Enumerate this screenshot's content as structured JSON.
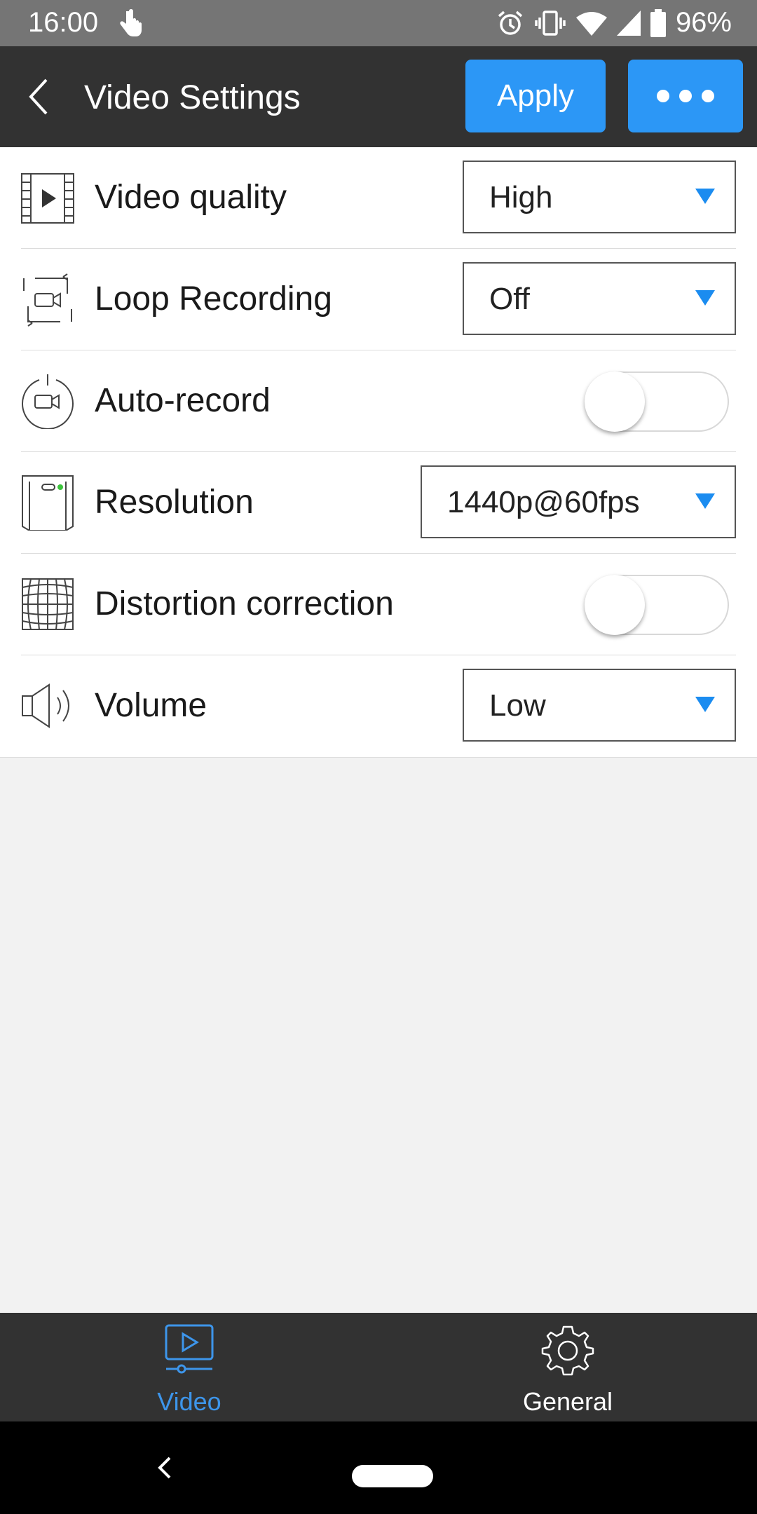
{
  "status_bar": {
    "time": "16:00",
    "battery": "96%"
  },
  "app_bar": {
    "title": "Video Settings",
    "apply_label": "Apply"
  },
  "settings": [
    {
      "label": "Video quality",
      "control": "dropdown",
      "value": "High",
      "icon": "film-play-icon"
    },
    {
      "label": "Loop Recording",
      "control": "dropdown",
      "value": "Off",
      "icon": "loop-camera-icon"
    },
    {
      "label": "Auto-record",
      "control": "toggle",
      "on": false,
      "icon": "power-camera-icon"
    },
    {
      "label": "Resolution",
      "control": "dropdown",
      "value": "1440p@60fps",
      "icon": "device-resolution-icon"
    },
    {
      "label": "Distortion correction",
      "control": "toggle",
      "on": false,
      "icon": "distortion-grid-icon"
    },
    {
      "label": "Volume",
      "control": "dropdown",
      "value": "Low",
      "icon": "speaker-icon"
    }
  ],
  "bottom_nav": {
    "video_label": "Video",
    "general_label": "General",
    "active": "Video"
  },
  "colors": {
    "accent": "#2c97f6",
    "appbar": "#323232",
    "active_tab": "#3d95ea"
  }
}
